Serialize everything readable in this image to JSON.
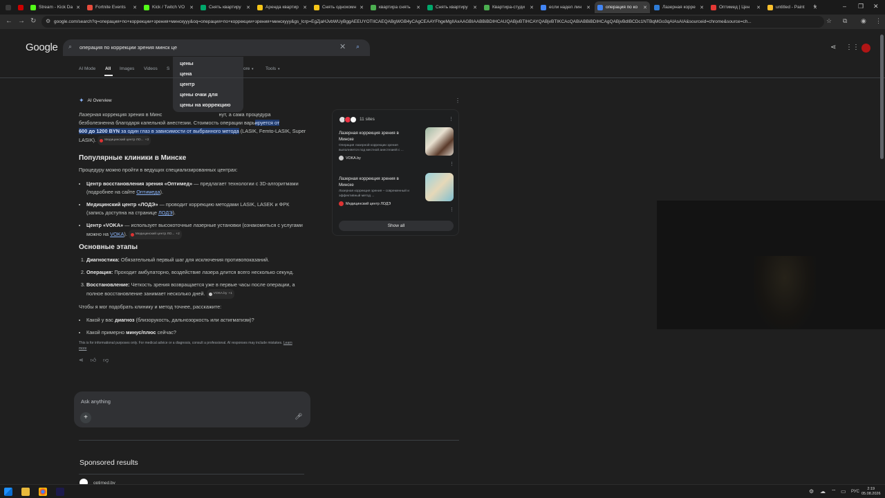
{
  "tabs": [
    {
      "title": "",
      "color": "#3a3a3a"
    },
    {
      "title": "",
      "color": "#cc0000"
    },
    {
      "title": "Stream - Kick Da",
      "color": "#53fc18"
    },
    {
      "title": "Fortnite Events",
      "color": "#e74c3c"
    },
    {
      "title": "Kick / Twitch VO",
      "color": "#53fc18"
    },
    {
      "title": "Снять квартиру",
      "color": "#00a86b"
    },
    {
      "title": "Аренда квартир",
      "color": "#f5c518"
    },
    {
      "title": "Снять однокомн",
      "color": "#f5c518"
    },
    {
      "title": "квартира снять",
      "color": "#4caf50"
    },
    {
      "title": "Снять квартиру",
      "color": "#00a86b"
    },
    {
      "title": "Квартира-студи",
      "color": "#4caf50"
    },
    {
      "title": "если надел лин",
      "color": "#4285f4"
    },
    {
      "title": "операция по ко",
      "color": "#4285f4"
    },
    {
      "title": "Лазерная корре",
      "color": "#2e7bd6"
    },
    {
      "title": "Оптимед | Цен",
      "color": "#e53935"
    },
    {
      "title": "untitled - Paint",
      "color": "#fbc02d"
    }
  ],
  "url": "google.com/search?q=операция+по+коррекции+зрения+минскyyy&oq=операция+по+коррекции+зрения+минскyyy&gs_lcrp=EgZjaHJvbWUyBggAEEUYOTIICAEQABgWGB4yCAgCEAAYFhgeMgIIAxAAGBIAABBiBDIHCAUQABjvBTIHCAYQABjvBTIKCAcQABiABBiBDIHCAgQABjvBdIBCDc1NTBqMGo3qAIAsAIA&sourceid=chrome&source=ch...",
  "logo": "Google",
  "search": {
    "query": "операция по коррекции зрения минск це"
  },
  "suggestions": [
    "цены",
    "цена",
    "центр",
    "цены очки для",
    "цены на коррекцию"
  ],
  "filters": {
    "ai_mode": "AI Mode",
    "all": "All",
    "images": "Images",
    "videos": "Videos",
    "s": "S",
    "more": "ore",
    "tools": "Tools"
  },
  "ai": {
    "title": "AI Overview",
    "intro": {
      "a": "Лазерная коррекция зрения в Минс",
      "b": "нут, а сама процедура безболезненна благодаря капельной анестезии. Стоимость операции варь",
      "hl1": "ируется от",
      "hl2": "600 до 1200 BYN",
      "hl3": " за один глаз в зависимости от выбранного метода",
      "c": " (LASIK, Femto-LASIK, Super LASIK).",
      "pill": "Медицинский центр ЛО...",
      "pill_count": "+3"
    },
    "clinics_title": "Популярные клиники в Минске",
    "clinics_intro": "Процедуру можно пройти в ведущих специализированных центрах:",
    "c1_b": "Центр восстановления зрения «Оптимед»",
    "c1_t": " — предлагает технологии с 3D-алгоритмами (подробнее на сайте ",
    "c1_l": "Оптимеда",
    "c1_e": ").",
    "c2_b": "Медицинский центр «ЛОДЭ»",
    "c2_t": " — проводит коррекцию методами LASIK, LASEK и ФРК (запись доступна на странице ",
    "c2_l": "ЛОДЭ",
    "c2_e": ").",
    "c3_b": "Центр «VOKA»",
    "c3_t": " — использует высокоточные лазерные установки (ознакомиться с услугами можно на ",
    "c3_l": "VOKA",
    "c3_e": ").",
    "c3_pill": "Медицинский центр ЛО...",
    "c3_pill_count": "+2",
    "steps_title": "Основные этапы",
    "s1_b": "Диагностика:",
    "s1_t": " Обязательный первый шаг для исключения противопоказаний.",
    "s2_b": "Операция:",
    "s2_t": " Проходит амбулаторно, воздействие лазера длится всего несколько секунд.",
    "s3_b": "Восстановление:",
    "s3_t": " Четкость зрения возвращается уже в первые часы после операции, а полное восстановление занимает несколько дней.",
    "s3_pill": "VOKA.by",
    "s3_pill_count": "+1",
    "ask_intro": "Чтобы я мог подобрать клинику и метод точнее, расскажите:",
    "q1_a": "Какой у вас ",
    "q1_b": "диагноз",
    "q1_c": " (близорукость, дальнозоркость или астигматизм)?",
    "q2_a": "Какой примерно ",
    "q2_b": "минус/плюс",
    "q2_c": " сейчас?",
    "disclaimer": "This is for informational purposes only. For medical advice or a diagnosis, consult a professional. AI responses may include mistakes.",
    "learn_more": "Learn more"
  },
  "ask": {
    "placeholder": "Ask anything"
  },
  "sources": {
    "count": "11 sites",
    "cards": [
      {
        "title": "Лазерная коррекция зрения в Минске",
        "desc": "Операция лазерной коррекции зрения выполняется под местной анестезией с ...",
        "source": "VOKA.by"
      },
      {
        "title": "Лазерная коррекция зрения в Минске",
        "desc": "Лазерная коррекция зрения – современный и эффективный метод ...",
        "source": "Медицинский центр ЛОДЭ"
      }
    ],
    "show_all": "Show all"
  },
  "sponsored": {
    "title": "Sponsored results",
    "site": "optimed.by"
  },
  "clock": {
    "time": "2:19",
    "date": "05.08.2026"
  },
  "lang": "РУС"
}
